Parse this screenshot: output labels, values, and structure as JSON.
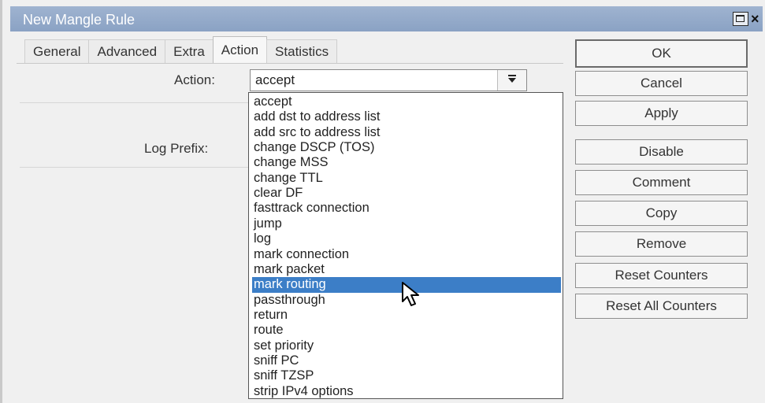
{
  "window": {
    "title": "New Mangle Rule"
  },
  "tabs": [
    "General",
    "Advanced",
    "Extra",
    "Action",
    "Statistics"
  ],
  "active_tab": "Action",
  "fields": {
    "action_label": "Action:",
    "action_value": "accept",
    "log_prefix_label": "Log Prefix:"
  },
  "dropdown": {
    "options": [
      "accept",
      "add dst to address list",
      "add src to address list",
      "change DSCP (TOS)",
      "change MSS",
      "change TTL",
      "clear DF",
      "fasttrack connection",
      "jump",
      "log",
      "mark connection",
      "mark packet",
      "mark routing",
      "passthrough",
      "return",
      "route",
      "set priority",
      "sniff PC",
      "sniff TZSP",
      "strip IPv4 options"
    ],
    "highlighted": "mark routing",
    "highlight_color": "#3c7ec7"
  },
  "buttons": {
    "ok": "OK",
    "cancel": "Cancel",
    "apply": "Apply",
    "disable": "Disable",
    "comment": "Comment",
    "copy": "Copy",
    "remove": "Remove",
    "reset_counters": "Reset Counters",
    "reset_all_counters": "Reset All Counters"
  },
  "icons": {
    "maximize": "maximize-icon",
    "close": "close-icon",
    "dropdown_arrow": "chevron-down-icon",
    "cursor": "mouse-pointer-icon"
  },
  "colors": {
    "titlebar": "#8aa2c4",
    "selection": "#3c7ec7"
  }
}
